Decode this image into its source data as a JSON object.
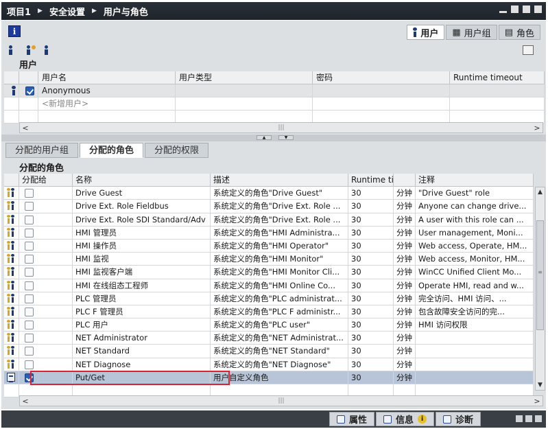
{
  "breadcrumb": [
    "项目1",
    "安全设置",
    "用户与角色"
  ],
  "top_tabs": [
    {
      "label": "用户",
      "icon": "user-icon",
      "active": true
    },
    {
      "label": "用户组",
      "icon": "user-group-icon",
      "active": false
    },
    {
      "label": "角色",
      "icon": "role-icon",
      "active": false
    }
  ],
  "users_section": {
    "title": "用户",
    "columns": [
      "用户名",
      "用户类型",
      "密码",
      "Runtime timeout"
    ],
    "rows": [
      {
        "name": "Anonymous",
        "type": "",
        "password": "",
        "timeout": "",
        "checked": true
      }
    ],
    "add_placeholder": "<新增用户>"
  },
  "lower_tabs": [
    {
      "label": "分配的用户组",
      "active": false
    },
    {
      "label": "分配的角色",
      "active": true
    },
    {
      "label": "分配的权限",
      "active": false
    }
  ],
  "roles_section": {
    "title": "分配的角色",
    "columns": [
      "分配给",
      "名称",
      "描述",
      "Runtime timeout",
      "注释"
    ],
    "rows": [
      {
        "assigned": false,
        "name": "Drive Guest",
        "desc": "系统定义的角色\"Drive Guest\"",
        "timeout": "30",
        "unit": "分钟",
        "comment": "\"Drive Guest\" role",
        "custom": false
      },
      {
        "assigned": false,
        "name": "Drive Ext. Role Fieldbus",
        "desc": "系统定义的角色\"Drive Ext. Role ...",
        "timeout": "30",
        "unit": "分钟",
        "comment": "Anyone can change drive...",
        "custom": false
      },
      {
        "assigned": false,
        "name": "Drive Ext. Role SDI Standard/Adv",
        "desc": "系统定义的角色\"Drive Ext. Role ...",
        "timeout": "30",
        "unit": "分钟",
        "comment": "A user with this role can ...",
        "custom": false
      },
      {
        "assigned": false,
        "name": "HMI 管理员",
        "desc": "系统定义的角色\"HMI Administra...",
        "timeout": "30",
        "unit": "分钟",
        "comment": "User management, Moni...",
        "custom": false
      },
      {
        "assigned": false,
        "name": "HMI 操作员",
        "desc": "系统定义的角色\"HMI Operator\"",
        "timeout": "30",
        "unit": "分钟",
        "comment": "Web access, Operate, HM...",
        "custom": false
      },
      {
        "assigned": false,
        "name": "HMI 监视",
        "desc": "系统定义的角色\"HMI Monitor\"",
        "timeout": "30",
        "unit": "分钟",
        "comment": "Web access, Monitor, HM...",
        "custom": false
      },
      {
        "assigned": false,
        "name": "HMI 监视客户端",
        "desc": "系统定义的角色\"HMI Monitor Cli...",
        "timeout": "30",
        "unit": "分钟",
        "comment": "WinCC Unified Client Mo...",
        "custom": false
      },
      {
        "assigned": false,
        "name": "HMI 在线组态工程师",
        "desc": "系统定义的角色\"HMI Online Co...",
        "timeout": "30",
        "unit": "分钟",
        "comment": "Operate HMI, read and w...",
        "custom": false
      },
      {
        "assigned": false,
        "name": "PLC 管理员",
        "desc": "系统定义的角色\"PLC administrat...",
        "timeout": "30",
        "unit": "分钟",
        "comment": "完全访问、HMI 访问、...",
        "custom": false
      },
      {
        "assigned": false,
        "name": "PLC F 管理员",
        "desc": "系统定义的角色\"PLC F administr...",
        "timeout": "30",
        "unit": "分钟",
        "comment": "包含故障安全访问的完...",
        "custom": false
      },
      {
        "assigned": false,
        "name": "PLC 用户",
        "desc": "系统定义的角色\"PLC user\"",
        "timeout": "30",
        "unit": "分钟",
        "comment": "HMI 访问权限",
        "custom": false
      },
      {
        "assigned": false,
        "name": "NET Administrator",
        "desc": "系统定义的角色\"NET Administrat...",
        "timeout": "30",
        "unit": "分钟",
        "comment": "",
        "custom": false
      },
      {
        "assigned": false,
        "name": "NET Standard",
        "desc": "系统定义的角色\"NET Standard\"",
        "timeout": "30",
        "unit": "分钟",
        "comment": "",
        "custom": false
      },
      {
        "assigned": false,
        "name": "NET Diagnose",
        "desc": "系统定义的角色\"NET Diagnose\"",
        "timeout": "30",
        "unit": "分钟",
        "comment": "",
        "custom": false
      },
      {
        "assigned": true,
        "name": "Put/Get",
        "desc": "用户自定义角色",
        "timeout": "30",
        "unit": "分钟",
        "comment": "",
        "custom": true
      }
    ]
  },
  "status_tabs": [
    {
      "label": "属性",
      "icon": "properties-icon"
    },
    {
      "label": "信息",
      "icon": "info-icon"
    },
    {
      "label": "诊断",
      "icon": "diagnostics-icon"
    }
  ],
  "info_badge": "i",
  "colors": {
    "highlight": "#e0202a",
    "selected_row": "#b8c4d8",
    "checkbox": "#2860b8"
  }
}
